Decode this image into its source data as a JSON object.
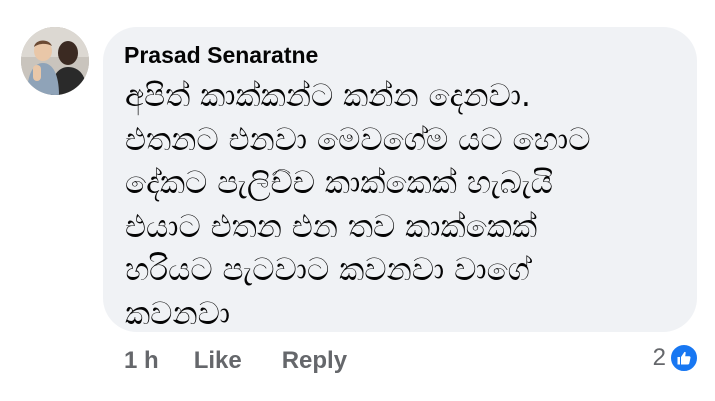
{
  "comment": {
    "author": "Prasad Senaratne",
    "text": "අපිත් කාක්කන්ට කන්න දෙනවා.\nඑතනට එනවා මෙවගේම යට හොට\nදේකට පැලිච්ච කාක්කෙක්  හැබැයි\nඑයාට එතන එන තව කාක්කෙක්\nහරියට පැටවාට කවනවා වාගේ\nකවනවා",
    "time": "1 h",
    "like_label": "Like",
    "reply_label": "Reply",
    "reaction_count": "2",
    "reaction_icon": "thumbs-up-icon"
  },
  "colors": {
    "bubble_bg": "#f0f2f5",
    "meta_text": "#65676b",
    "like_blue": "#1877f2",
    "text": "#050505"
  }
}
